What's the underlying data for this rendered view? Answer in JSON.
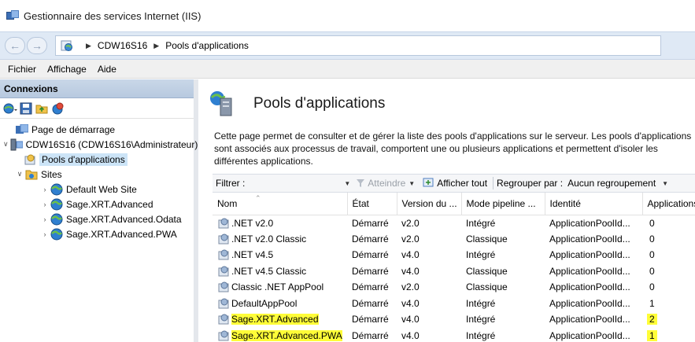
{
  "window": {
    "title": "Gestionnaire des services Internet (IIS)"
  },
  "breadcrumb": {
    "items": [
      "CDW16S16",
      "Pools d'applications"
    ]
  },
  "menu": {
    "items": [
      "Fichier",
      "Affichage",
      "Aide"
    ]
  },
  "connections": {
    "header": "Connexions",
    "tree": {
      "start_page": "Page de démarrage",
      "server": "CDW16S16 (CDW16S16\\Administrateur)",
      "app_pools": "Pools d'applications",
      "sites": "Sites",
      "site_items": [
        "Default Web Site",
        "Sage.XRT.Advanced",
        "Sage.XRT.Advanced.Odata",
        "Sage.XRT.Advanced.PWA"
      ]
    }
  },
  "content": {
    "title": "Pools d'applications",
    "description": "Cette page permet de consulter et de gérer la liste des pools d'applications sur le serveur. Les pools d'applications\nsont associés aux processus de travail, comportent une ou plusieurs applications et permettent d'isoler les\ndifférentes applications."
  },
  "filterbar": {
    "filter_label": "Filtrer :",
    "filter_value": "",
    "go_label": "Atteindre",
    "show_all_label": "Afficher tout",
    "group_label": "Regrouper par :",
    "group_value": "Aucun regroupement"
  },
  "table": {
    "columns": [
      "Nom",
      "État",
      "Version du ...",
      "Mode pipeline ...",
      "Identité",
      "Applications"
    ],
    "rows": [
      {
        "name": ".NET v2.0",
        "state": "Démarré",
        "version": "v2.0",
        "pipeline": "Intégré",
        "identity": "ApplicationPoolId...",
        "apps": "0",
        "highlight": false
      },
      {
        "name": ".NET v2.0 Classic",
        "state": "Démarré",
        "version": "v2.0",
        "pipeline": "Classique",
        "identity": "ApplicationPoolId...",
        "apps": "0",
        "highlight": false
      },
      {
        "name": ".NET v4.5",
        "state": "Démarré",
        "version": "v4.0",
        "pipeline": "Intégré",
        "identity": "ApplicationPoolId...",
        "apps": "0",
        "highlight": false
      },
      {
        "name": ".NET v4.5 Classic",
        "state": "Démarré",
        "version": "v4.0",
        "pipeline": "Classique",
        "identity": "ApplicationPoolId...",
        "apps": "0",
        "highlight": false
      },
      {
        "name": "Classic .NET AppPool",
        "state": "Démarré",
        "version": "v2.0",
        "pipeline": "Classique",
        "identity": "ApplicationPoolId...",
        "apps": "0",
        "highlight": false
      },
      {
        "name": "DefaultAppPool",
        "state": "Démarré",
        "version": "v4.0",
        "pipeline": "Intégré",
        "identity": "ApplicationPoolId...",
        "apps": "1",
        "highlight": false
      },
      {
        "name": "Sage.XRT.Advanced",
        "state": "Démarré",
        "version": "v4.0",
        "pipeline": "Intégré",
        "identity": "ApplicationPoolId...",
        "apps": "2",
        "highlight": true
      },
      {
        "name": "Sage.XRT.Advanced.PWA",
        "state": "Démarré",
        "version": "v4.0",
        "pipeline": "Intégré",
        "identity": "ApplicationPoolId...",
        "apps": "1",
        "highlight": true
      }
    ]
  },
  "colors": {
    "highlight": "#fffd38",
    "selection": "#cce4f7",
    "address_bar": "#dfe9f5"
  }
}
